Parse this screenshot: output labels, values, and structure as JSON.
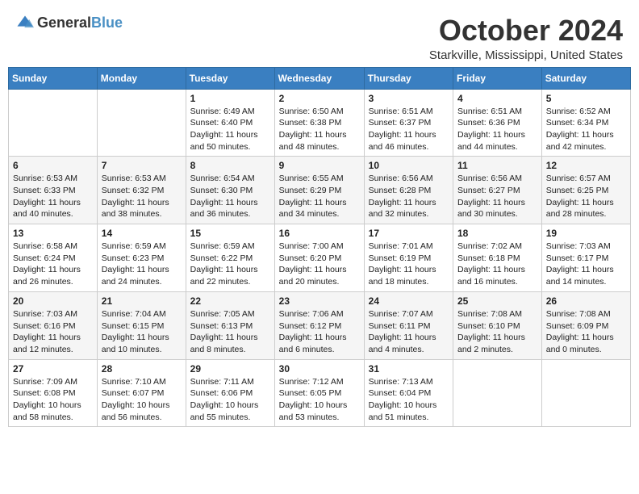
{
  "header": {
    "logo_general": "General",
    "logo_blue": "Blue",
    "month": "October 2024",
    "location": "Starkville, Mississippi, United States"
  },
  "weekdays": [
    "Sunday",
    "Monday",
    "Tuesday",
    "Wednesday",
    "Thursday",
    "Friday",
    "Saturday"
  ],
  "weeks": [
    [
      {
        "day": "",
        "sunrise": "",
        "sunset": "",
        "daylight": ""
      },
      {
        "day": "",
        "sunrise": "",
        "sunset": "",
        "daylight": ""
      },
      {
        "day": "1",
        "sunrise": "Sunrise: 6:49 AM",
        "sunset": "Sunset: 6:40 PM",
        "daylight": "Daylight: 11 hours and 50 minutes."
      },
      {
        "day": "2",
        "sunrise": "Sunrise: 6:50 AM",
        "sunset": "Sunset: 6:38 PM",
        "daylight": "Daylight: 11 hours and 48 minutes."
      },
      {
        "day": "3",
        "sunrise": "Sunrise: 6:51 AM",
        "sunset": "Sunset: 6:37 PM",
        "daylight": "Daylight: 11 hours and 46 minutes."
      },
      {
        "day": "4",
        "sunrise": "Sunrise: 6:51 AM",
        "sunset": "Sunset: 6:36 PM",
        "daylight": "Daylight: 11 hours and 44 minutes."
      },
      {
        "day": "5",
        "sunrise": "Sunrise: 6:52 AM",
        "sunset": "Sunset: 6:34 PM",
        "daylight": "Daylight: 11 hours and 42 minutes."
      }
    ],
    [
      {
        "day": "6",
        "sunrise": "Sunrise: 6:53 AM",
        "sunset": "Sunset: 6:33 PM",
        "daylight": "Daylight: 11 hours and 40 minutes."
      },
      {
        "day": "7",
        "sunrise": "Sunrise: 6:53 AM",
        "sunset": "Sunset: 6:32 PM",
        "daylight": "Daylight: 11 hours and 38 minutes."
      },
      {
        "day": "8",
        "sunrise": "Sunrise: 6:54 AM",
        "sunset": "Sunset: 6:30 PM",
        "daylight": "Daylight: 11 hours and 36 minutes."
      },
      {
        "day": "9",
        "sunrise": "Sunrise: 6:55 AM",
        "sunset": "Sunset: 6:29 PM",
        "daylight": "Daylight: 11 hours and 34 minutes."
      },
      {
        "day": "10",
        "sunrise": "Sunrise: 6:56 AM",
        "sunset": "Sunset: 6:28 PM",
        "daylight": "Daylight: 11 hours and 32 minutes."
      },
      {
        "day": "11",
        "sunrise": "Sunrise: 6:56 AM",
        "sunset": "Sunset: 6:27 PM",
        "daylight": "Daylight: 11 hours and 30 minutes."
      },
      {
        "day": "12",
        "sunrise": "Sunrise: 6:57 AM",
        "sunset": "Sunset: 6:25 PM",
        "daylight": "Daylight: 11 hours and 28 minutes."
      }
    ],
    [
      {
        "day": "13",
        "sunrise": "Sunrise: 6:58 AM",
        "sunset": "Sunset: 6:24 PM",
        "daylight": "Daylight: 11 hours and 26 minutes."
      },
      {
        "day": "14",
        "sunrise": "Sunrise: 6:59 AM",
        "sunset": "Sunset: 6:23 PM",
        "daylight": "Daylight: 11 hours and 24 minutes."
      },
      {
        "day": "15",
        "sunrise": "Sunrise: 6:59 AM",
        "sunset": "Sunset: 6:22 PM",
        "daylight": "Daylight: 11 hours and 22 minutes."
      },
      {
        "day": "16",
        "sunrise": "Sunrise: 7:00 AM",
        "sunset": "Sunset: 6:20 PM",
        "daylight": "Daylight: 11 hours and 20 minutes."
      },
      {
        "day": "17",
        "sunrise": "Sunrise: 7:01 AM",
        "sunset": "Sunset: 6:19 PM",
        "daylight": "Daylight: 11 hours and 18 minutes."
      },
      {
        "day": "18",
        "sunrise": "Sunrise: 7:02 AM",
        "sunset": "Sunset: 6:18 PM",
        "daylight": "Daylight: 11 hours and 16 minutes."
      },
      {
        "day": "19",
        "sunrise": "Sunrise: 7:03 AM",
        "sunset": "Sunset: 6:17 PM",
        "daylight": "Daylight: 11 hours and 14 minutes."
      }
    ],
    [
      {
        "day": "20",
        "sunrise": "Sunrise: 7:03 AM",
        "sunset": "Sunset: 6:16 PM",
        "daylight": "Daylight: 11 hours and 12 minutes."
      },
      {
        "day": "21",
        "sunrise": "Sunrise: 7:04 AM",
        "sunset": "Sunset: 6:15 PM",
        "daylight": "Daylight: 11 hours and 10 minutes."
      },
      {
        "day": "22",
        "sunrise": "Sunrise: 7:05 AM",
        "sunset": "Sunset: 6:13 PM",
        "daylight": "Daylight: 11 hours and 8 minutes."
      },
      {
        "day": "23",
        "sunrise": "Sunrise: 7:06 AM",
        "sunset": "Sunset: 6:12 PM",
        "daylight": "Daylight: 11 hours and 6 minutes."
      },
      {
        "day": "24",
        "sunrise": "Sunrise: 7:07 AM",
        "sunset": "Sunset: 6:11 PM",
        "daylight": "Daylight: 11 hours and 4 minutes."
      },
      {
        "day": "25",
        "sunrise": "Sunrise: 7:08 AM",
        "sunset": "Sunset: 6:10 PM",
        "daylight": "Daylight: 11 hours and 2 minutes."
      },
      {
        "day": "26",
        "sunrise": "Sunrise: 7:08 AM",
        "sunset": "Sunset: 6:09 PM",
        "daylight": "Daylight: 11 hours and 0 minutes."
      }
    ],
    [
      {
        "day": "27",
        "sunrise": "Sunrise: 7:09 AM",
        "sunset": "Sunset: 6:08 PM",
        "daylight": "Daylight: 10 hours and 58 minutes."
      },
      {
        "day": "28",
        "sunrise": "Sunrise: 7:10 AM",
        "sunset": "Sunset: 6:07 PM",
        "daylight": "Daylight: 10 hours and 56 minutes."
      },
      {
        "day": "29",
        "sunrise": "Sunrise: 7:11 AM",
        "sunset": "Sunset: 6:06 PM",
        "daylight": "Daylight: 10 hours and 55 minutes."
      },
      {
        "day": "30",
        "sunrise": "Sunrise: 7:12 AM",
        "sunset": "Sunset: 6:05 PM",
        "daylight": "Daylight: 10 hours and 53 minutes."
      },
      {
        "day": "31",
        "sunrise": "Sunrise: 7:13 AM",
        "sunset": "Sunset: 6:04 PM",
        "daylight": "Daylight: 10 hours and 51 minutes."
      },
      {
        "day": "",
        "sunrise": "",
        "sunset": "",
        "daylight": ""
      },
      {
        "day": "",
        "sunrise": "",
        "sunset": "",
        "daylight": ""
      }
    ]
  ]
}
